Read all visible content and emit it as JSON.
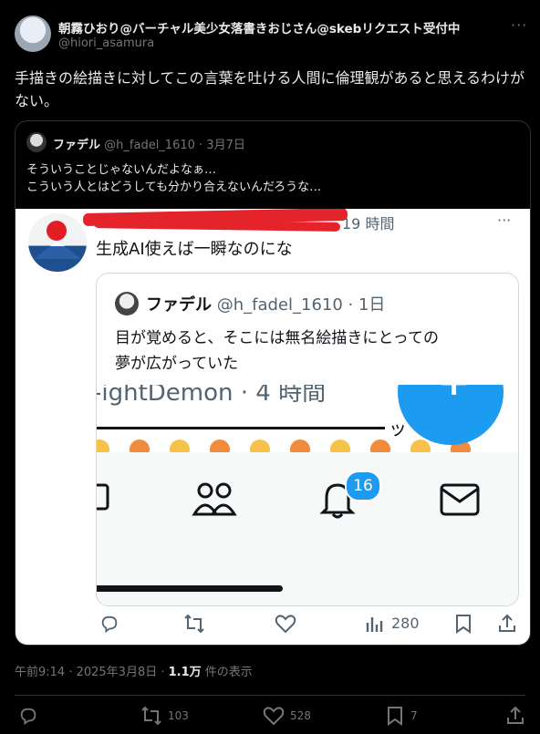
{
  "tweet": {
    "display_name": "朝霧ひおり@バーチャル美少女落書きおじさん@skebリクエスト受付中",
    "handle": "@hiori_asamura",
    "more": "···",
    "text": "手描きの絵描きに対してこの言葉を吐ける人間に倫理観があると思えるわけがない。"
  },
  "quote": {
    "name": "ファデル",
    "handle": "@h_fadel_1610",
    "date": "· 3月7日",
    "line1": "そういうことじゃないんだよなぁ…",
    "line2": "こういう人とはどうしても分かり合えないんだろうな…"
  },
  "screenshot": {
    "time": "19 時間",
    "more": "···",
    "text": "生成AI使えば一瞬なのにな",
    "inner": {
      "name": "ファデル",
      "handle": "@h_fadel_1610 · 1日",
      "line1": "目が覚めると、そこには無名絵描きにとっての",
      "line2": "夢が広がっていた"
    },
    "cut_text": "-ightDemon · 4 時間",
    "cut_tail": "ッ",
    "fab_plus": "+",
    "notification_badge": "16",
    "reply_count": "",
    "views": "280"
  },
  "meta": {
    "timestamp": "午前9:14 · 2025年3月8日 ·",
    "views_num": "1.1万",
    "views_label": "件の表示"
  },
  "actions": {
    "reply": "",
    "retweets": "103",
    "likes": "528",
    "bookmarks": "7"
  },
  "colors": {
    "background": "#000000",
    "text": "#e7e9ea",
    "muted": "#71767b",
    "border": "#2f3336",
    "accent": "#1d9bf0",
    "redaction": "#e5232b"
  }
}
